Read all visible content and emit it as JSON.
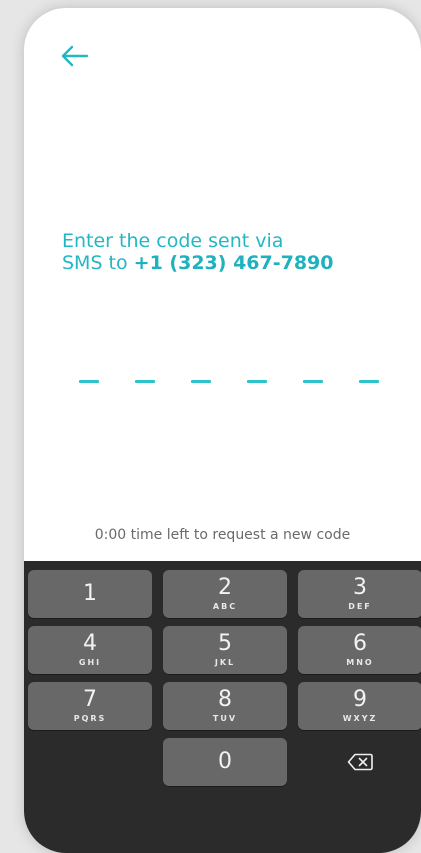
{
  "prompt": {
    "line1": "Enter the code sent via",
    "line2_prefix": "SMS to ",
    "phone_number": "+1 (323) 467-7890"
  },
  "code_length": 6,
  "timer_text": "0:00 time left to request a new code",
  "keypad": {
    "k1": {
      "num": "1",
      "letters": ""
    },
    "k2": {
      "num": "2",
      "letters": "ABC"
    },
    "k3": {
      "num": "3",
      "letters": "DEF"
    },
    "k4": {
      "num": "4",
      "letters": "GHI"
    },
    "k5": {
      "num": "5",
      "letters": "JKL"
    },
    "k6": {
      "num": "6",
      "letters": "MNO"
    },
    "k7": {
      "num": "7",
      "letters": "PQRS"
    },
    "k8": {
      "num": "8",
      "letters": "TUV"
    },
    "k9": {
      "num": "9",
      "letters": "WXYZ"
    },
    "k0": {
      "num": "0",
      "letters": ""
    }
  },
  "colors": {
    "accent": "#23b7c4",
    "keyboard_bg": "#2b2b2b",
    "key_bg": "#686868"
  },
  "icons": {
    "back": "arrow-left-icon",
    "delete": "backspace-icon"
  }
}
